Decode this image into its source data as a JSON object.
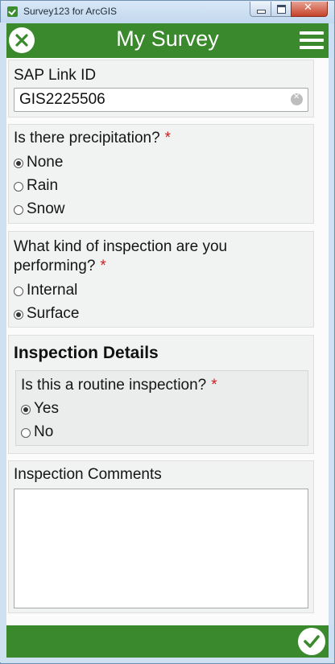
{
  "window": {
    "title": "Survey123 for ArcGIS"
  },
  "header": {
    "title": "My Survey"
  },
  "fields": {
    "sap_link": {
      "label": "SAP Link ID",
      "value": "GIS2225506"
    },
    "precipitation": {
      "label": "Is there precipitation?",
      "required": "*",
      "options": [
        "None",
        "Rain",
        "Snow"
      ],
      "selected": "None"
    },
    "inspection_kind": {
      "label_line1": "What kind of inspection are you",
      "label_line2": "performing?",
      "required": "*",
      "options": [
        "Internal",
        "Surface"
      ],
      "selected": "Surface"
    },
    "details": {
      "title": "Inspection Details",
      "routine": {
        "label": "Is this a routine inspection?",
        "required": "*",
        "options": [
          "Yes",
          "No"
        ],
        "selected": "Yes"
      }
    },
    "comments": {
      "label": "Inspection Comments",
      "value": ""
    }
  },
  "colors": {
    "brand_green": "#3a8a2d",
    "required_red": "#d61c1c"
  },
  "icons": {
    "close": "close-circle-icon",
    "menu": "hamburger-menu-icon",
    "submit": "checkmark-circle-icon",
    "clear": "clear-x-icon"
  }
}
